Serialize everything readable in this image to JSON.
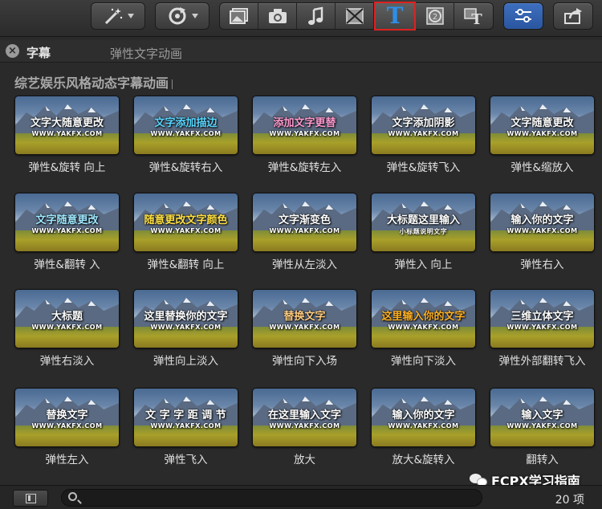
{
  "toolbar": {
    "icons": [
      "magic-wand-icon",
      "rotate-icon",
      "clip-icon",
      "camera-icon",
      "music-icon",
      "transition-icon",
      "text-icon",
      "generator-icon",
      "theme-icon",
      "inspector-icon",
      "share-icon"
    ]
  },
  "header": {
    "title": "字幕",
    "subtitle": "弹性文字动画"
  },
  "category": "综艺娱乐风格动态字幕动画",
  "tiles": [
    {
      "main": "文字大随意更改",
      "url": "WWW.YAKFX.COM",
      "label": "弹性&旋转 向上",
      "color": "#ffffff"
    },
    {
      "main": "文字添加描边",
      "url": "WWW.YAKFX.COM",
      "label": "弹性&旋转右入",
      "color": "#5ad6ff"
    },
    {
      "main": "添加文字更替",
      "url": "WWW.YAKFX.COM",
      "label": "弹性&旋转左入",
      "color": "#ff9ad0"
    },
    {
      "main": "文字添加阴影",
      "url": "WWW.YAKFX.COM",
      "label": "弹性&旋转飞入",
      "color": "#ffffff"
    },
    {
      "main": "文字随意更改",
      "url": "WWW.YAKFX.COM",
      "label": "弹性&缩放入",
      "color": "#ffffff"
    },
    {
      "main": "文字随意更改",
      "url": "WWW.YAKFX.COM",
      "label": "弹性&翻转 入",
      "color": "#9fe8ff"
    },
    {
      "main": "随意更改文字颜色",
      "url": "WWW.YAKFX.COM",
      "label": "弹性&翻转 向上",
      "color": "#ffe040"
    },
    {
      "main": "文字渐变色",
      "url": "WWW.YAKFX.COM",
      "label": "弹性从左淡入",
      "color": "#ffffff"
    },
    {
      "main": "大标题这里输入",
      "url": "小标题说明文字",
      "label": "弹性入 向上",
      "color": "#ffffff"
    },
    {
      "main": "输入你的文字",
      "url": "WWW.YAKFX.COM",
      "label": "弹性右入",
      "color": "#ffffff"
    },
    {
      "main": "大标题",
      "url": "WWW.YAKFX.COM",
      "label": "弹性右淡入",
      "color": "#ffffff"
    },
    {
      "main": "这里替换你的文字",
      "url": "WWW.YAKFX.COM",
      "label": "弹性向上淡入",
      "color": "#ffffff"
    },
    {
      "main": "替换文字",
      "url": "WWW.YAKFX.COM",
      "label": "弹性向下入场",
      "color": "#ffcc80"
    },
    {
      "main": "这里输入你的文字",
      "url": "WWW.YAKFX.COM",
      "label": "弹性向下淡入",
      "color": "#ffb020"
    },
    {
      "main": "三维立体文字",
      "url": "WWW.YAKFX.COM",
      "label": "弹性外部翻转飞入",
      "color": "#ffffff"
    },
    {
      "main": "替换文字",
      "url": "WWW.YAKFX.COM",
      "label": "弹性左入",
      "color": "#ffffff"
    },
    {
      "main": "文 字 字 距 调 节",
      "url": "WWW.YAKFX.COM",
      "label": "弹性飞入",
      "color": "#ffffff"
    },
    {
      "main": "在这里输入文字",
      "url": "WWW.YAKFX.COM",
      "label": "放大",
      "color": "#ffffff"
    },
    {
      "main": "输入你的文字",
      "url": "WWW.YAKFX.COM",
      "label": "放大&旋转入",
      "color": "#ffffff"
    },
    {
      "main": "输入文字",
      "url": "WWW.YAKFX.COM",
      "label": "翻转入",
      "color": "#ffffff"
    }
  ],
  "footer": {
    "count": "20 项",
    "search_placeholder": ""
  },
  "watermark": "FCPX学习指南"
}
